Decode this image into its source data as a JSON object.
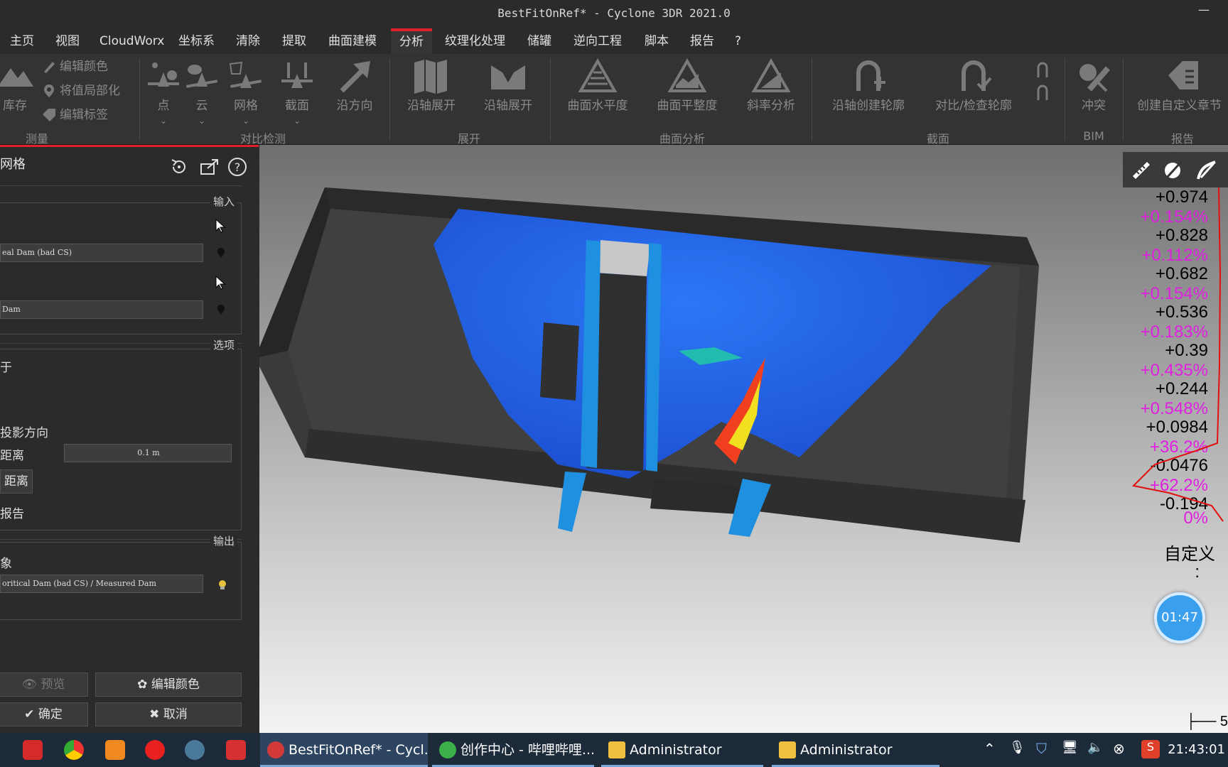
{
  "window": {
    "title": "BestFitOnRef* - Cyclone 3DR 2021.0",
    "minimize": "—"
  },
  "menu": {
    "items": [
      "主页",
      "视图",
      "CloudWorx",
      "坐标系",
      "清除",
      "提取",
      "曲面建模",
      "分析",
      "纹理化处理",
      "储罐",
      "逆向工程",
      "脚本",
      "报告",
      "?"
    ],
    "active": "分析"
  },
  "ribbon": {
    "measure": {
      "storage": "库存",
      "edit_color": "编辑颜色",
      "localize": "将值局部化",
      "edit_label": "编辑标签",
      "group": "测量"
    },
    "compare": {
      "point": "点",
      "cloud": "云",
      "mesh": "网格",
      "section": "截面",
      "direction": "沿方向",
      "group": "对比检测"
    },
    "unfold": {
      "axis1": "沿轴展开",
      "axis2": "沿轴展开",
      "group": "展开"
    },
    "surface": {
      "levelness": "曲面水平度",
      "flatness": "曲面平整度",
      "slope": "斜率分析",
      "group": "曲面分析"
    },
    "section": {
      "create": "沿轴创建轮廓",
      "compare": "对比/检查轮廓",
      "group": "截面"
    },
    "bim": {
      "clash": "冲突",
      "group": "BIM"
    },
    "report": {
      "custom": "创建自定义章节",
      "group": "报告"
    }
  },
  "panel": {
    "title": "网格",
    "input_label": "输入",
    "ref_field": "eal Dam (bad CS)",
    "meas_field": "Dam",
    "options_label": "选项",
    "opt_based_on": "于",
    "opt_projection": "投影方向",
    "opt_distance": "距离",
    "distance_value": "0.1 m",
    "opt_distance2": "距离",
    "opt_report": "报告",
    "output_label": "输出",
    "out_object": "象",
    "out_field": "oritical Dam (bad CS) / Measured Dam",
    "preview": "预览",
    "edit_color": "编辑颜色",
    "ok": "确定",
    "cancel": "取消"
  },
  "legend": {
    "values": [
      "+0.974",
      "+0.828",
      "+0.682",
      "+0.536",
      "+0.39",
      "+0.244",
      "+0.0984",
      "-0.0476",
      "-0.194"
    ],
    "percents": [
      "+0.154%",
      "+0.112%",
      "+0.154%",
      "+0.183%",
      "+0.435%",
      "+0.548%",
      "+36.2%",
      "+62.2%",
      "0%"
    ],
    "custom": "自定义",
    "colon": ":"
  },
  "viewport": {
    "scale_mark": "├── 5"
  },
  "timer": "01:47",
  "taskbar": {
    "tasks": [
      "BestFitOnRef* - Cycl...",
      "创作中心 - 哔哩哔哩...",
      "Administrator",
      "Administrator"
    ],
    "clock": "21:43:01"
  },
  "colors": {
    "accent": "#e0202a",
    "legend_percent": "#e020e0",
    "taskbar": "#1c2a3a"
  }
}
